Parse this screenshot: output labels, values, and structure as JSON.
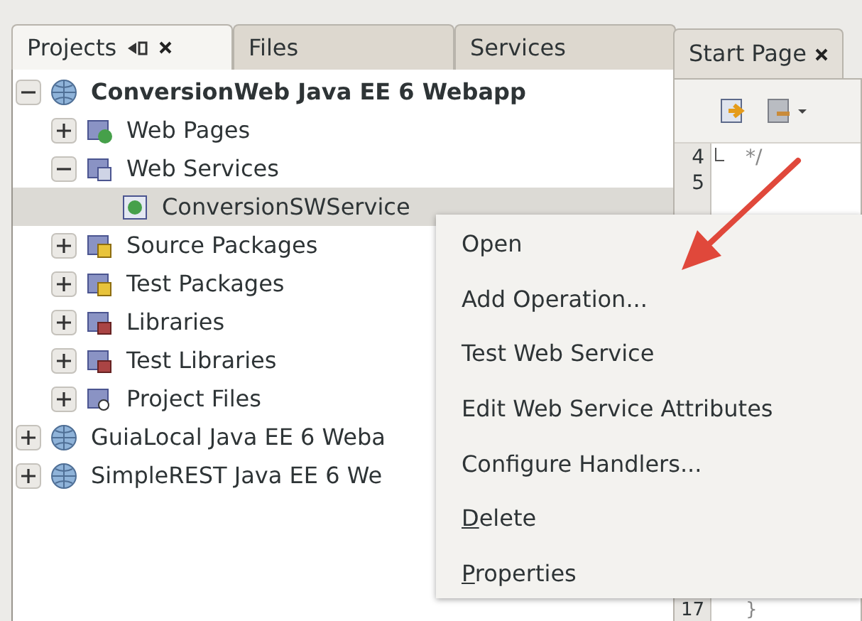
{
  "panel_tabs": [
    {
      "label": "Projects",
      "selected": true
    },
    {
      "label": "Files",
      "selected": false
    },
    {
      "label": "Services",
      "selected": false
    }
  ],
  "tree": [
    {
      "label": "ConversionWeb Java EE 6 Webapp",
      "kind": "project",
      "main_project": true,
      "expanded": true,
      "selected": false,
      "children": [
        {
          "label": "Web Pages",
          "kind": "web-pages",
          "expanded": false,
          "selected": false
        },
        {
          "label": "Web Services",
          "kind": "web-services",
          "expanded": true,
          "selected": false,
          "children": [
            {
              "label": "ConversionSWService",
              "kind": "service",
              "selected": true
            }
          ]
        },
        {
          "label": "Source Packages",
          "kind": "package",
          "expanded": false,
          "selected": false
        },
        {
          "label": "Test Packages",
          "kind": "package",
          "expanded": false,
          "selected": false
        },
        {
          "label": "Libraries",
          "kind": "library",
          "expanded": false,
          "selected": false
        },
        {
          "label": "Test Libraries",
          "kind": "library",
          "expanded": false,
          "selected": false
        },
        {
          "label": "Project Files",
          "kind": "project-files",
          "expanded": false,
          "selected": false
        }
      ]
    },
    {
      "label": "GuiaLocal Java EE 6 Weba",
      "kind": "project",
      "expanded": false,
      "selected": false
    },
    {
      "label": "SimpleREST Java EE 6 We",
      "kind": "project",
      "expanded": false,
      "selected": false
    }
  ],
  "editor": {
    "tab": "Start Page",
    "code_lines": [
      {
        "number": "4",
        "code": "*/",
        "fold_end": true
      },
      {
        "number": "5"
      },
      {
        "number": "17",
        "code": "}"
      }
    ]
  },
  "context_menu": [
    {
      "label": "Open"
    },
    {
      "label": "Add Operation..."
    },
    {
      "label": "Test Web Service"
    },
    {
      "label": "Edit Web Service Attributes"
    },
    {
      "label": "Configure Handlers..."
    },
    {
      "label": "Delete",
      "mnemonic": true
    },
    {
      "label": "Properties",
      "mnemonic": true
    }
  ]
}
